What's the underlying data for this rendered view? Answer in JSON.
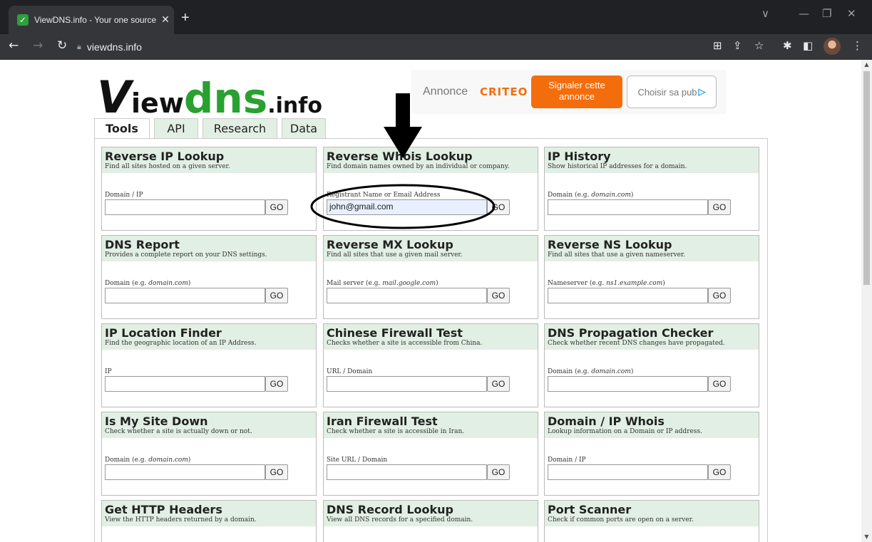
{
  "browser": {
    "tab_title": "ViewDNS.info - Your one source f",
    "tab_close": "✕",
    "new_tab": "+",
    "url": "viewdns.info",
    "window_controls": [
      "∨",
      "—",
      "❐",
      "✕"
    ]
  },
  "logo": {
    "v": "V",
    "iew": "iew",
    "dns": "dns",
    "info": ".info"
  },
  "ad": {
    "label": "Annonce",
    "brand": "CRITEO",
    "report_line1": "Signaler cette",
    "report_line2": "annonce",
    "choose": "Choisir sa pub"
  },
  "tabs": [
    "Tools",
    "API",
    "Research",
    "Data"
  ],
  "cards": [
    {
      "title": "Reverse IP Lookup",
      "desc": "Find all sites hosted on a given server.",
      "field": "Domain / IP",
      "value": "",
      "go": "GO"
    },
    {
      "title": "Reverse Whois Lookup",
      "desc": "Find domain names owned by an individual or company.",
      "field": "Registrant Name or Email Address",
      "value": "john@gmail.com",
      "go": "GO"
    },
    {
      "title": "IP History",
      "desc": "Show historical IP addresses for a domain.",
      "field": "Domain (e.g. ",
      "field_ex": "domain.com",
      "field_end": ")",
      "value": "",
      "go": "GO"
    },
    {
      "title": "DNS Report",
      "desc": "Provides a complete report on your DNS settings.",
      "field": "Domain (e.g. ",
      "field_ex": "domain.com",
      "field_end": ")",
      "value": "",
      "go": "GO"
    },
    {
      "title": "Reverse MX Lookup",
      "desc": "Find all sites that use a given mail server.",
      "field": "Mail server (e.g. ",
      "field_ex": "mail.google.com",
      "field_end": ")",
      "value": "",
      "go": "GO"
    },
    {
      "title": "Reverse NS Lookup",
      "desc": "Find all sites that use a given nameserver.",
      "field": "Nameserver (e.g. ",
      "field_ex": "ns1.example.com",
      "field_end": ")",
      "value": "",
      "go": "GO"
    },
    {
      "title": "IP Location Finder",
      "desc": "Find the geographic location of an IP Address.",
      "field": "IP",
      "value": "",
      "go": "GO"
    },
    {
      "title": "Chinese Firewall Test",
      "desc": "Checks whether a site is accessible from China.",
      "field": "URL / Domain",
      "value": "",
      "go": "GO"
    },
    {
      "title": "DNS Propagation Checker",
      "desc": "Check whether recent DNS changes have propagated.",
      "field": "Domain (e.g. ",
      "field_ex": "domain.com",
      "field_end": ")",
      "value": "",
      "go": "GO"
    },
    {
      "title": "Is My Site Down",
      "desc": "Check whether a site is actually down or not.",
      "field": "Domain (e.g. ",
      "field_ex": "domain.com",
      "field_end": ")",
      "value": "",
      "go": "GO"
    },
    {
      "title": "Iran Firewall Test",
      "desc": "Check whether a site is accessible in Iran.",
      "field": "Site URL / Domain",
      "value": "",
      "go": "GO"
    },
    {
      "title": "Domain / IP Whois",
      "desc": "Lookup information on a Domain or IP address.",
      "field": "Domain / IP",
      "value": "",
      "go": "GO"
    },
    {
      "title": "Get HTTP Headers",
      "desc": "View the HTTP headers returned by a domain.",
      "field": "",
      "value": "",
      "go": ""
    },
    {
      "title": "DNS Record Lookup",
      "desc": "View all DNS records for a specified domain.",
      "field": "",
      "value": "",
      "go": ""
    },
    {
      "title": "Port Scanner",
      "desc": "Check if common ports are open on a server.",
      "field": "",
      "value": "",
      "go": ""
    }
  ],
  "colors": {
    "accent_green": "#2aa031",
    "card_header": "#e2efe4",
    "ad_orange": "#f46d0d"
  }
}
